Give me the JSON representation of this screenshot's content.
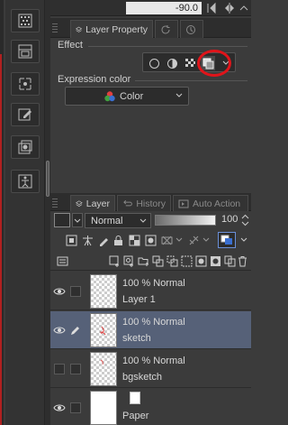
{
  "top_row": {
    "value": "-90.0"
  },
  "property_panel": {
    "tabs": [
      {
        "label": "Layer Property",
        "active": true
      }
    ],
    "effect": {
      "label": "Effect"
    },
    "expression_color": {
      "label": "Expression color",
      "value": "Color"
    }
  },
  "layer_panel": {
    "tabs": [
      {
        "label": "Layer",
        "active": true
      },
      {
        "label": "History",
        "active": false
      },
      {
        "label": "Auto Action",
        "active": false
      }
    ],
    "blend_mode": "Normal",
    "opacity": {
      "value": "100",
      "level": 1.0
    },
    "layers": [
      {
        "mode": "100 % Normal",
        "name": "Layer 1",
        "visible": true,
        "selected": false,
        "editing": false,
        "thumbnail": "transparent"
      },
      {
        "mode": "100 % Normal",
        "name": "sketch",
        "visible": true,
        "selected": true,
        "editing": true,
        "thumbnail": "sketch"
      },
      {
        "mode": "100 % Normal",
        "name": "bgsketch",
        "visible": false,
        "selected": false,
        "editing": false,
        "thumbnail": "transparent"
      },
      {
        "name": "Paper",
        "visible": true,
        "selected": false,
        "editing": false,
        "thumbnail": "white"
      }
    ]
  },
  "colors": {
    "highlight": "#e0141a",
    "selected_row": "#566178",
    "panel_bg": "#3b3b3b"
  }
}
